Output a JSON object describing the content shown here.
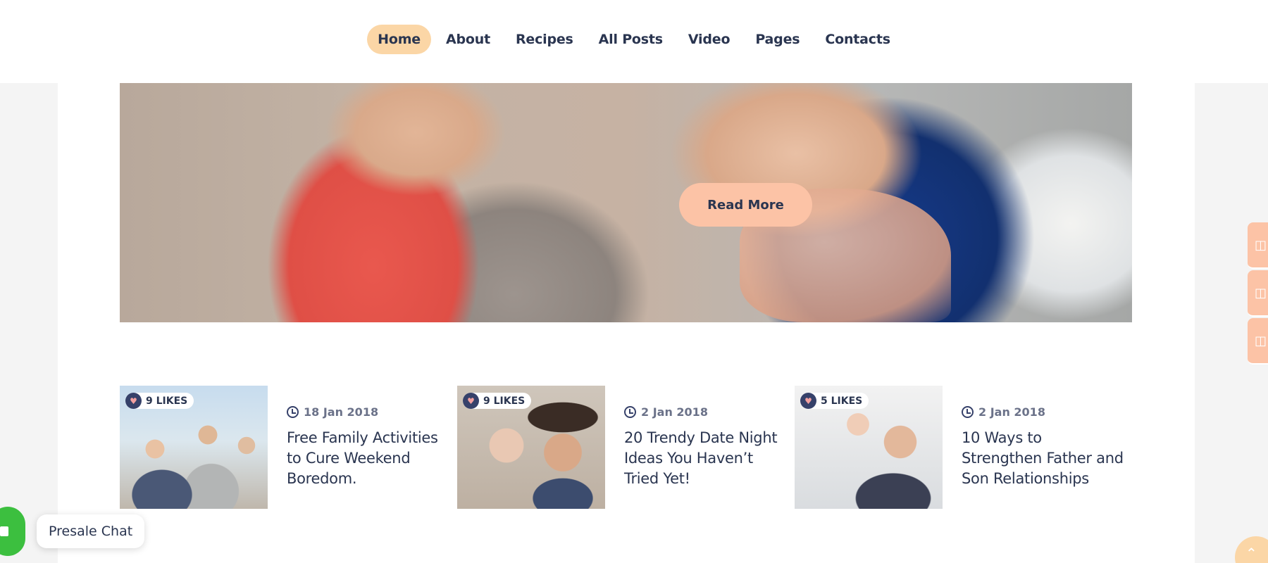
{
  "nav": {
    "items": [
      {
        "label": "Home",
        "active": true
      },
      {
        "label": "About"
      },
      {
        "label": "Recipes"
      },
      {
        "label": "All Posts"
      },
      {
        "label": "Video"
      },
      {
        "label": "Pages"
      },
      {
        "label": "Contacts"
      }
    ]
  },
  "hero": {
    "button_label": "Read More",
    "slides": 3,
    "active_slide": 1
  },
  "posts": [
    {
      "likes": "9 LIKES",
      "date": "18 Jan 2018",
      "title": "Free Family Activities to Cure Weekend Boredom."
    },
    {
      "likes": "9 LIKES",
      "date": "2 Jan 2018",
      "title": "20 Trendy Date Night Ideas You Haven’t Tried Yet!"
    },
    {
      "likes": "5 LIKES",
      "date": "2 Jan 2018",
      "title": "10 Ways to Strengthen Father and Son Relationships"
    }
  ],
  "chat": {
    "label": "Presale Chat"
  },
  "icons": {
    "like": "heart-icon",
    "date": "clock-icon",
    "chat": "chat-icon",
    "scroll": "arrow-up-icon"
  },
  "colors": {
    "accent": "#fcc3a6",
    "nav_active": "#fbd6a6",
    "text": "#2a3550",
    "chat_green": "#3cbf3f"
  }
}
